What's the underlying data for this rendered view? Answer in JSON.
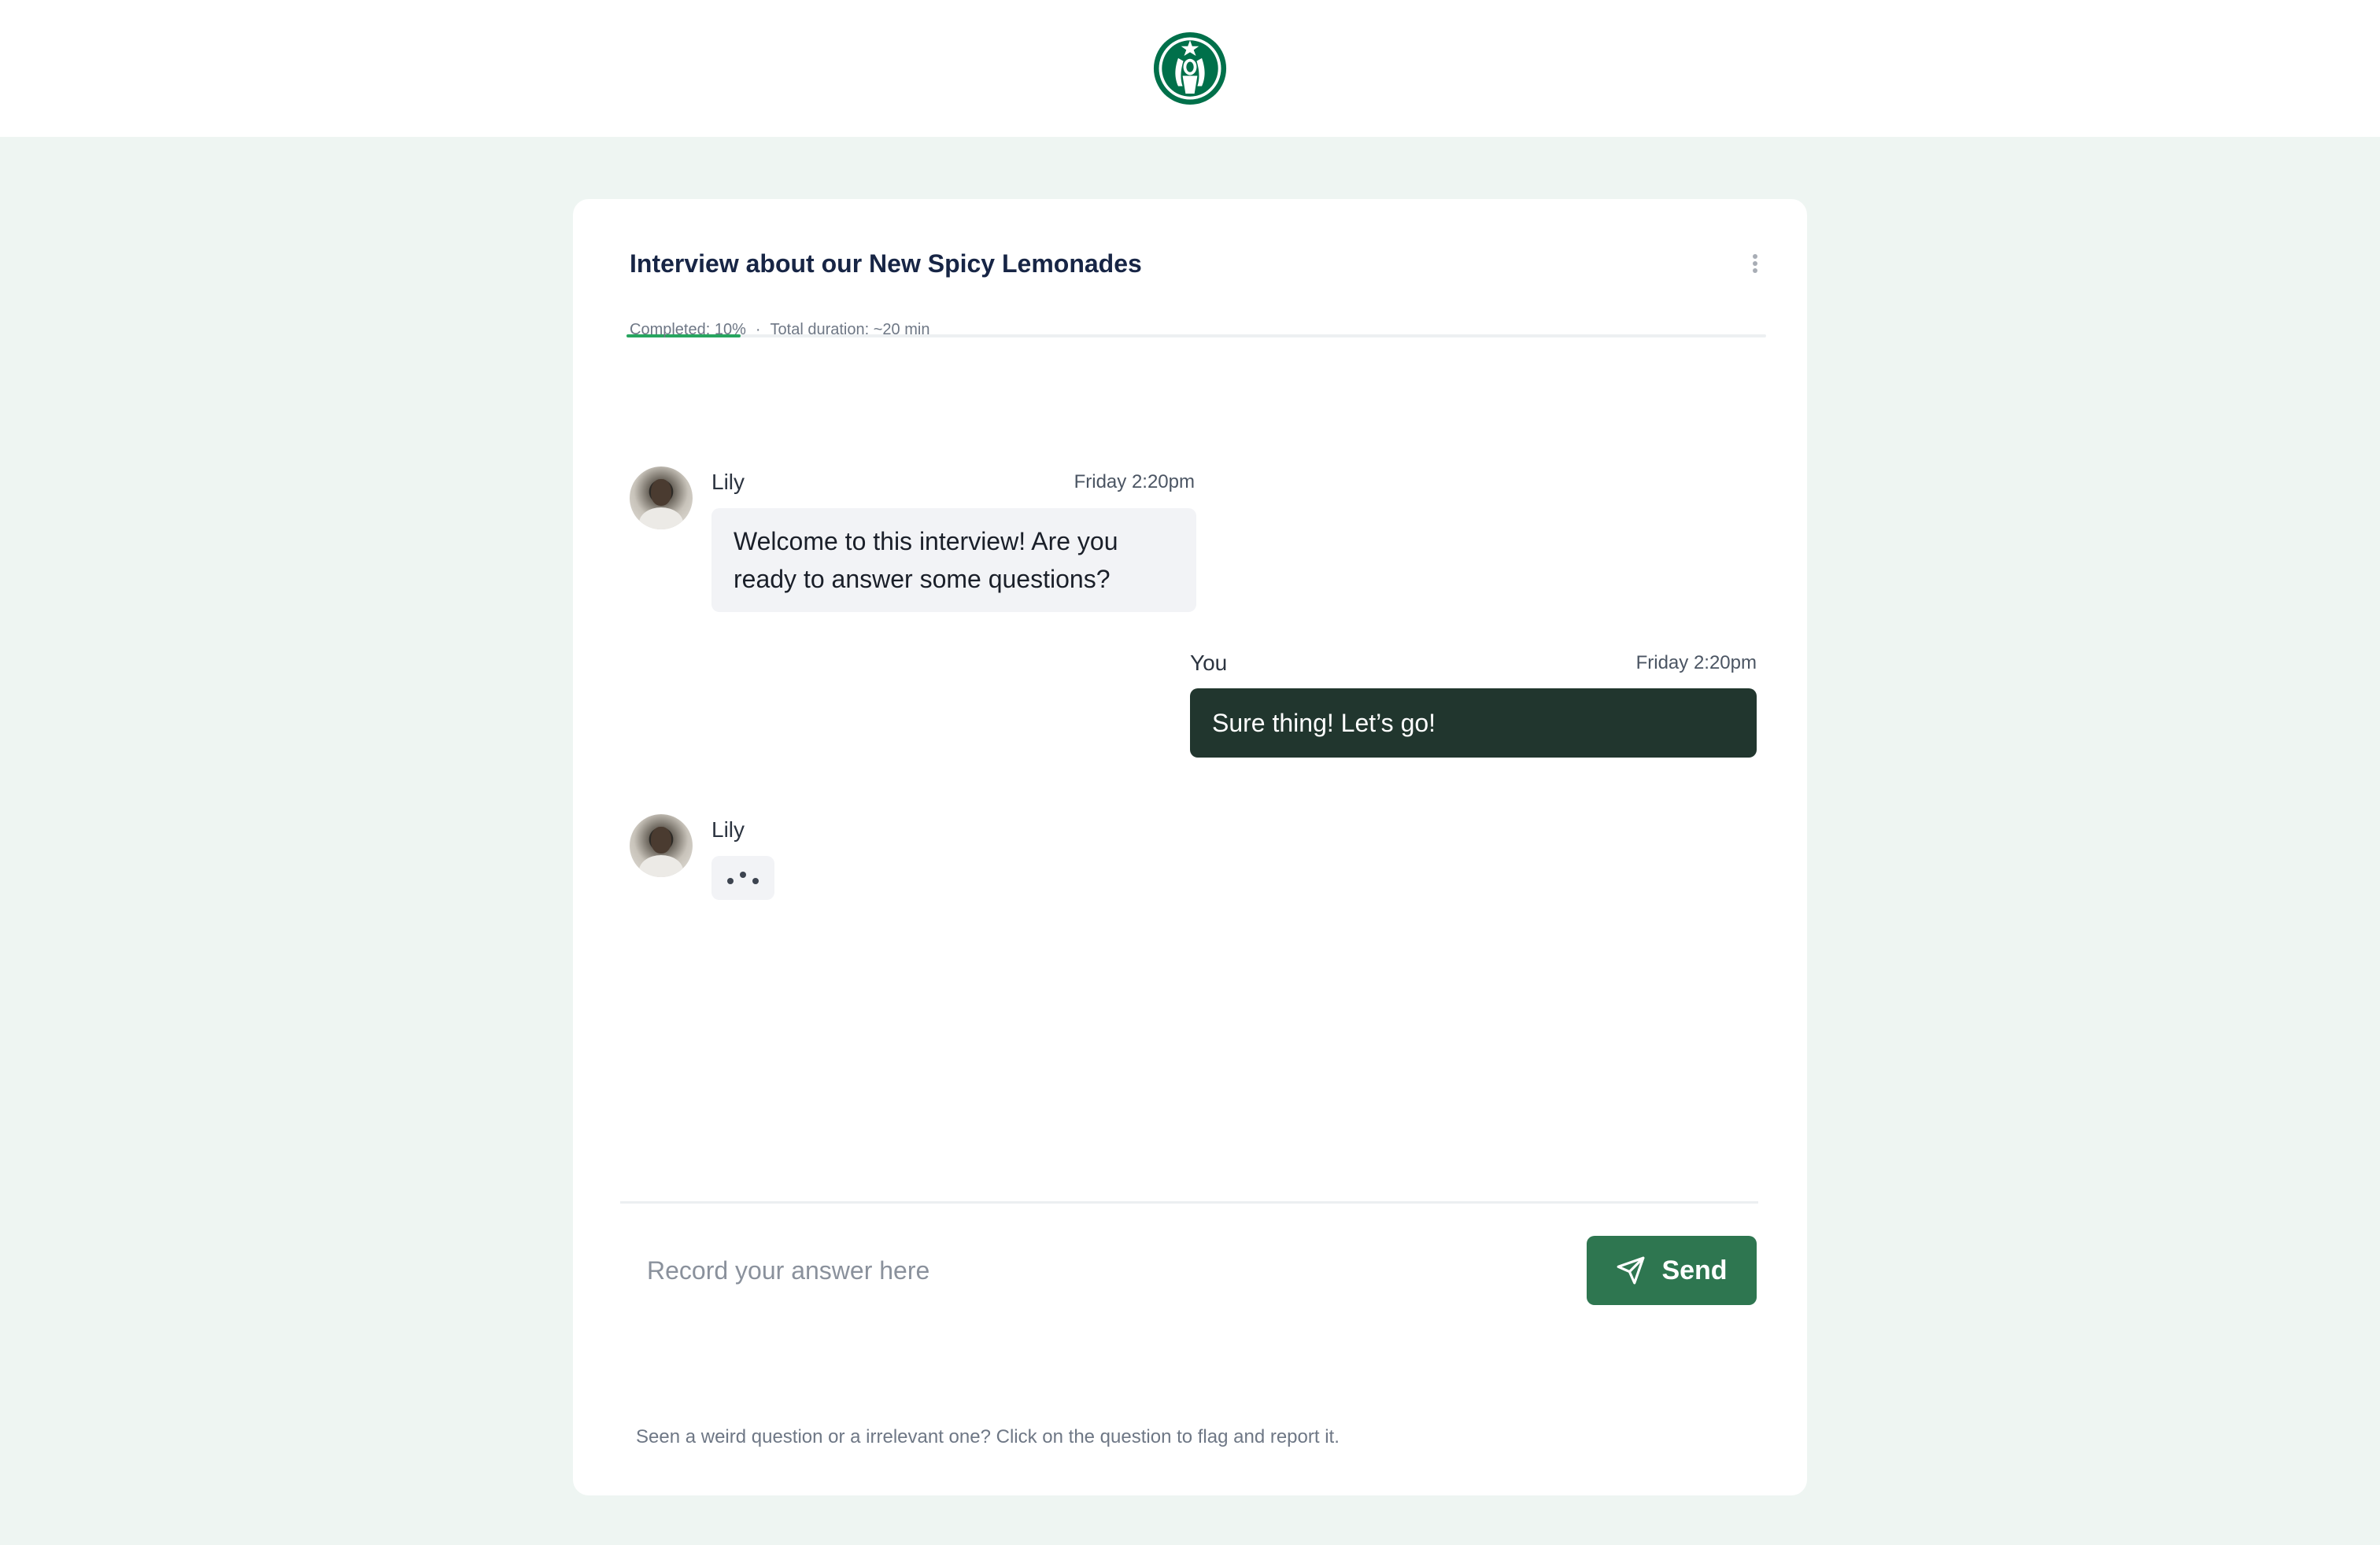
{
  "header": {
    "logo_icon": "starbucks-siren-logo",
    "brand_color": "#00704a"
  },
  "interview": {
    "title": "Interview about our New Spicy Lemonades",
    "completed_label": "Completed: 10%",
    "completed_fraction": 0.1,
    "separator": "·",
    "duration_label": "Total duration: ~20 min",
    "menu_icon": "vertical-ellipsis-icon"
  },
  "messages": [
    {
      "sender": "Lily",
      "time": "Friday 2:20pm",
      "text": "Welcome to this interview! Are you ready to answer some questions?"
    },
    {
      "sender": "You",
      "time": "Friday 2:20pm",
      "text": "Sure thing! Let’s go!"
    },
    {
      "sender": "Lily",
      "typing": true
    }
  ],
  "composer": {
    "placeholder": "Record your answer here",
    "send_label": "Send",
    "send_icon": "paper-plane-icon"
  },
  "footer": {
    "note": "Seen a weird question or a irrelevant one? Click on the question to flag and report it."
  },
  "colors": {
    "page_bg": "#eef5f2",
    "accent": "#27a55f",
    "send_button": "#2e7650",
    "outgoing_bubble": "#21362e",
    "incoming_bubble": "#f2f3f6"
  }
}
